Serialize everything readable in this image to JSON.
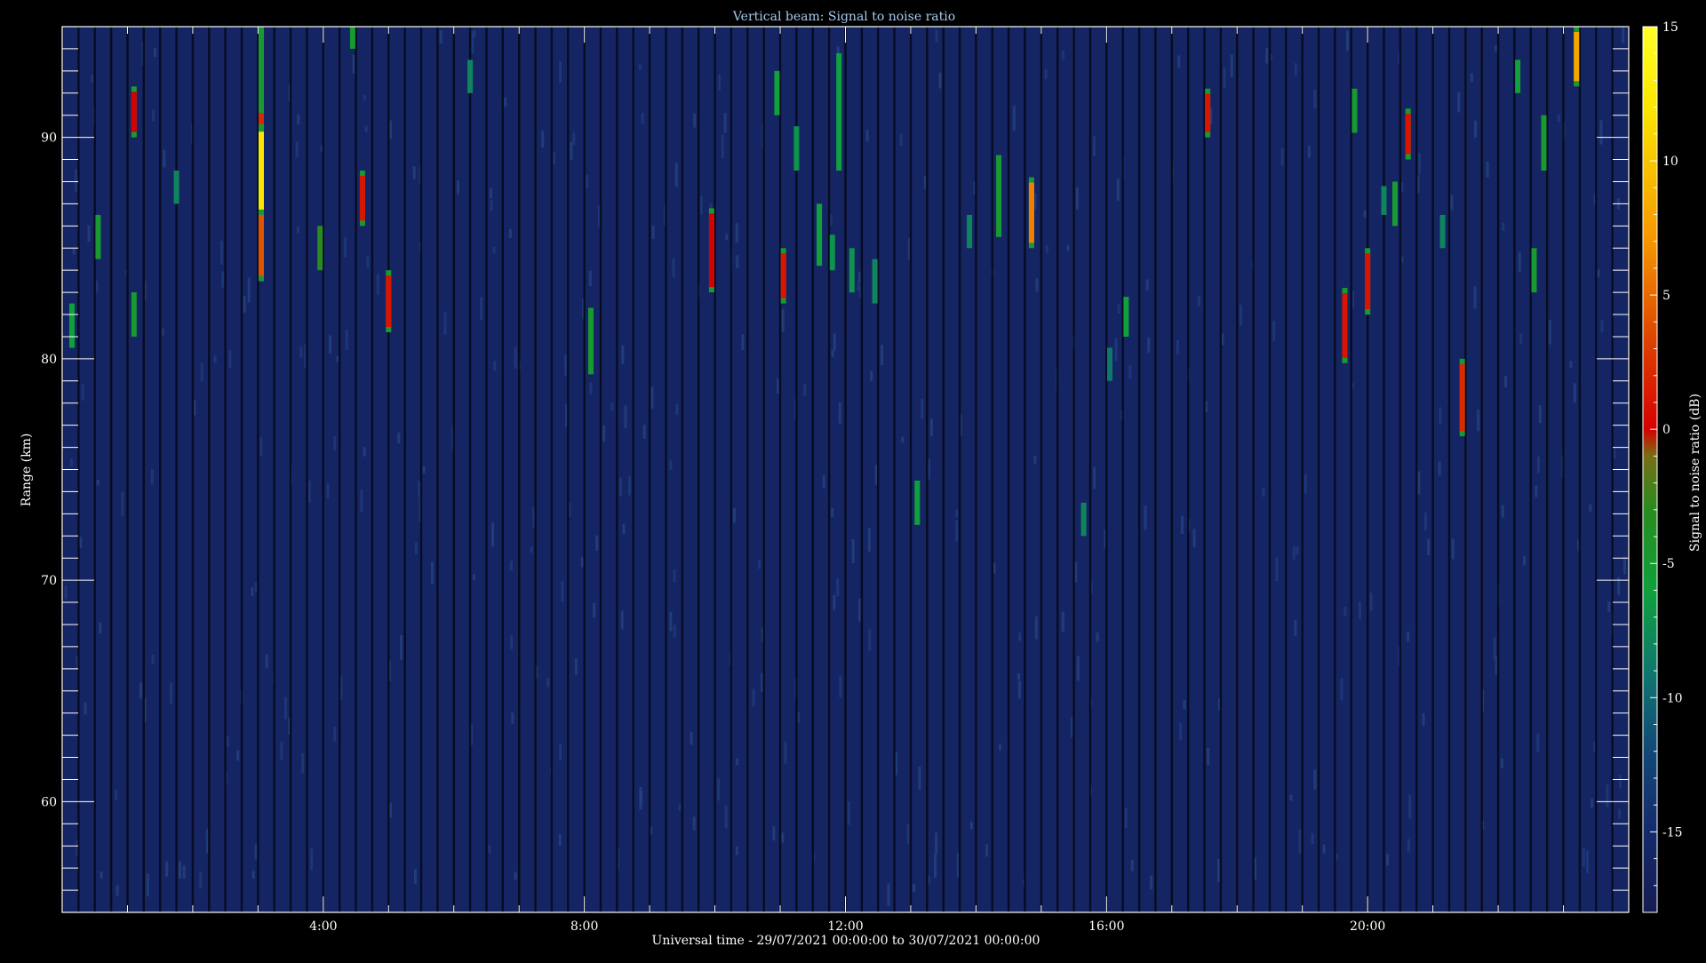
{
  "chart_data": {
    "type": "heatmap",
    "title": "Vertical beam: Signal to noise ratio",
    "xlabel": "Universal time - 29/07/2021 00:00:00 to 30/07/2021 00:00:00",
    "ylabel": "Range (km)",
    "colorbar_label": "Signal to noise ratio (dB)",
    "xlim": [
      0,
      24
    ],
    "ylim": [
      55,
      95
    ],
    "x_ticks": [
      {
        "value": 4,
        "label": "4:00"
      },
      {
        "value": 8,
        "label": "8:00"
      },
      {
        "value": 12,
        "label": "12:00"
      },
      {
        "value": 16,
        "label": "16:00"
      },
      {
        "value": 20,
        "label": "20:00"
      }
    ],
    "y_ticks": [
      {
        "value": 60,
        "label": "60"
      },
      {
        "value": 70,
        "label": "70"
      },
      {
        "value": 80,
        "label": "80"
      },
      {
        "value": 90,
        "label": "90"
      }
    ],
    "colorbar_range": [
      -18,
      15
    ],
    "colorbar_ticks": [
      {
        "value": 15,
        "label": "15"
      },
      {
        "value": 10,
        "label": "10"
      },
      {
        "value": 5,
        "label": "5"
      },
      {
        "value": 0,
        "label": "0"
      },
      {
        "value": -5,
        "label": "-5"
      },
      {
        "value": -10,
        "label": "-10"
      },
      {
        "value": -15,
        "label": "-15"
      }
    ],
    "background_snr_db": -16,
    "features": [
      {
        "t": 0.15,
        "r_min": 80.5,
        "r_max": 82.5,
        "snr": -6
      },
      {
        "t": 0.55,
        "r_min": 84.5,
        "r_max": 86.5,
        "snr": -5
      },
      {
        "t": 1.1,
        "r_min": 81.0,
        "r_max": 83.0,
        "snr": -5
      },
      {
        "t": 1.1,
        "r_min": 90.0,
        "r_max": 92.3,
        "snr": 0
      },
      {
        "t": 1.75,
        "r_min": 87.0,
        "r_max": 88.5,
        "snr": -8
      },
      {
        "t": 3.05,
        "r_min": 83.5,
        "r_max": 95.0,
        "snr": 4
      },
      {
        "t": 3.05,
        "r_min": 86.5,
        "r_max": 90.5,
        "snr": 12
      },
      {
        "t": 3.05,
        "r_min": 90.5,
        "r_max": 91.2,
        "snr": 2
      },
      {
        "t": 3.05,
        "r_min": 91.2,
        "r_max": 95.0,
        "snr": -5
      },
      {
        "t": 3.95,
        "r_min": 84.0,
        "r_max": 86.0,
        "snr": -3
      },
      {
        "t": 4.45,
        "r_min": 94.0,
        "r_max": 95.0,
        "snr": -5
      },
      {
        "t": 4.6,
        "r_min": 86.0,
        "r_max": 88.5,
        "snr": 1
      },
      {
        "t": 5.0,
        "r_min": 81.2,
        "r_max": 84.0,
        "snr": 1
      },
      {
        "t": 6.25,
        "r_min": 92.0,
        "r_max": 93.5,
        "snr": -8
      },
      {
        "t": 8.1,
        "r_min": 79.3,
        "r_max": 82.3,
        "snr": -5
      },
      {
        "t": 9.95,
        "r_min": 83.0,
        "r_max": 86.8,
        "snr": 0
      },
      {
        "t": 10.95,
        "r_min": 91.0,
        "r_max": 93.0,
        "snr": -6
      },
      {
        "t": 11.05,
        "r_min": 82.5,
        "r_max": 85.0,
        "snr": 1
      },
      {
        "t": 11.25,
        "r_min": 88.5,
        "r_max": 90.5,
        "snr": -7
      },
      {
        "t": 11.9,
        "r_min": 88.5,
        "r_max": 93.8,
        "snr": -6
      },
      {
        "t": 11.6,
        "r_min": 84.2,
        "r_max": 87.0,
        "snr": -6
      },
      {
        "t": 11.8,
        "r_min": 84.0,
        "r_max": 85.6,
        "snr": -7
      },
      {
        "t": 12.1,
        "r_min": 83.0,
        "r_max": 85.0,
        "snr": -7
      },
      {
        "t": 12.45,
        "r_min": 82.5,
        "r_max": 84.5,
        "snr": -8
      },
      {
        "t": 13.1,
        "r_min": 72.5,
        "r_max": 74.5,
        "snr": -6
      },
      {
        "t": 13.9,
        "r_min": 85.0,
        "r_max": 86.5,
        "snr": -8
      },
      {
        "t": 14.35,
        "r_min": 85.5,
        "r_max": 89.2,
        "snr": -5
      },
      {
        "t": 14.85,
        "r_min": 85.0,
        "r_max": 88.2,
        "snr": 6
      },
      {
        "t": 15.65,
        "r_min": 72.0,
        "r_max": 73.5,
        "snr": -8
      },
      {
        "t": 16.05,
        "r_min": 79.0,
        "r_max": 80.5,
        "snr": -9
      },
      {
        "t": 16.3,
        "r_min": 81.0,
        "r_max": 82.8,
        "snr": -6
      },
      {
        "t": 17.55,
        "r_min": 90.0,
        "r_max": 92.2,
        "snr": 1
      },
      {
        "t": 19.65,
        "r_min": 79.8,
        "r_max": 83.2,
        "snr": 1
      },
      {
        "t": 19.8,
        "r_min": 90.2,
        "r_max": 92.2,
        "snr": -5
      },
      {
        "t": 20.0,
        "r_min": 82.0,
        "r_max": 85.0,
        "snr": 1
      },
      {
        "t": 20.25,
        "r_min": 86.5,
        "r_max": 87.8,
        "snr": -8
      },
      {
        "t": 20.42,
        "r_min": 86.0,
        "r_max": 88.0,
        "snr": -5
      },
      {
        "t": 20.62,
        "r_min": 89.0,
        "r_max": 91.3,
        "snr": 1
      },
      {
        "t": 21.15,
        "r_min": 85.0,
        "r_max": 86.5,
        "snr": -8
      },
      {
        "t": 21.45,
        "r_min": 76.5,
        "r_max": 80.0,
        "snr": 2
      },
      {
        "t": 22.3,
        "r_min": 92.0,
        "r_max": 93.5,
        "snr": -6
      },
      {
        "t": 22.55,
        "r_min": 83.0,
        "r_max": 85.0,
        "snr": -5
      },
      {
        "t": 22.7,
        "r_min": 88.5,
        "r_max": 91.0,
        "snr": -5
      },
      {
        "t": 23.2,
        "r_min": 92.3,
        "r_max": 95.0,
        "snr": 8
      }
    ]
  }
}
